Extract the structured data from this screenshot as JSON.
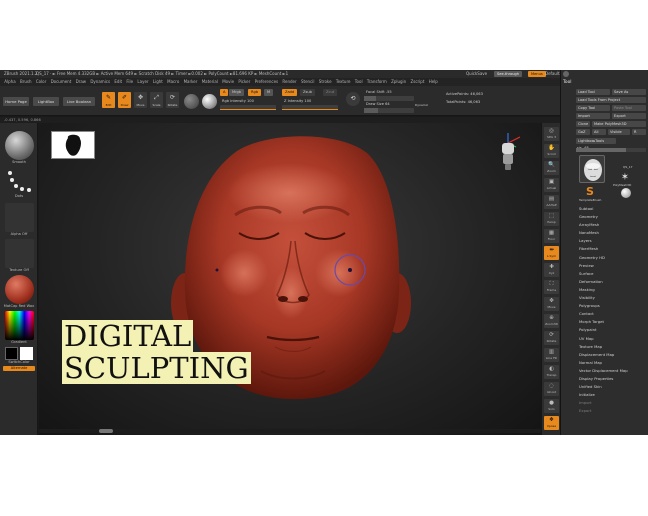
{
  "window": {
    "title": "ZBrush 2021.1.2",
    "title_stats": "QS_17  ·  ► Free Mem 4.332GB ► Active Mem 649 ► Scratch Disk 49 ► Timer ►0.002 ► PolyCount ►81.696 KP ► MeshCount ►1",
    "quicksave": "QuickSave",
    "seethrough": "See-through",
    "menus_btn": "Menus",
    "script": "DefaultZScript"
  },
  "menubar": [
    "Alpha",
    "Brush",
    "Color",
    "Document",
    "Draw",
    "Dynamics",
    "Edit",
    "File",
    "Layer",
    "Light",
    "Macro",
    "Marker",
    "Material",
    "Movie",
    "Picker",
    "Preferences",
    "Render",
    "Stencil",
    "Stroke",
    "Texture",
    "Tool",
    "Transform",
    "Zplugin",
    "Zscript",
    "Help"
  ],
  "shelf": {
    "home_page": "Home Page",
    "lightbox": "LightBox",
    "live_boolean": "Live Boolean",
    "tools": [
      {
        "label": "Edit",
        "icon": "edit-icon",
        "glyph": "✎"
      },
      {
        "label": "Draw",
        "icon": "draw-icon",
        "glyph": "✐"
      },
      {
        "label": "Move",
        "icon": "move-icon",
        "glyph": "✥"
      },
      {
        "label": "Scale",
        "icon": "scale-icon",
        "glyph": "⤢"
      },
      {
        "label": "Rotate",
        "icon": "rotate-icon",
        "glyph": "⟳"
      }
    ],
    "a_chip": "A",
    "mrgb": "Mrgb",
    "rgb": "Rgb",
    "m": "M",
    "rgb_intensity_label": "Rgb Intensity",
    "rgb_intensity": "100",
    "zadd": "Zadd",
    "zsub": "Zsub",
    "zcut": "Zcut",
    "z_intensity_label": "Z Intensity",
    "z_intensity": "100",
    "focal_shift_label": "Focal Shift",
    "focal_shift": "-55",
    "draw_size_label": "Draw Size",
    "draw_size": "64",
    "dynamic": "Dynamic",
    "active_points_label": "ActivePoints:",
    "active_points": "46,063",
    "total_points_label": "TotalPoints:",
    "total_points": "46,063"
  },
  "status": "-0.437, 0.596, 0.866",
  "left_tray": {
    "brush": "Smooth",
    "stroke": "Dots",
    "alpha": "Alpha Off",
    "texture": "Texture Off",
    "material": "MatCap Red Wax",
    "gradient": "Gradient",
    "switch_color": "SwitchColor",
    "alternate": "Alternate"
  },
  "viewport": {
    "overlay_line1": "DIGITAL",
    "overlay_line2": "SCULPTING"
  },
  "right_shelf": [
    {
      "label": "SPix 3",
      "icon": "spix-icon",
      "glyph": "◎"
    },
    {
      "label": "Scroll",
      "icon": "scroll-icon",
      "glyph": "✋"
    },
    {
      "label": "Zoom",
      "icon": "zoom-icon",
      "glyph": "🔍"
    },
    {
      "label": "Actual",
      "icon": "actual-icon",
      "glyph": "▣"
    },
    {
      "label": "AAHalf",
      "icon": "aahalf-icon",
      "glyph": "▤"
    },
    {
      "label": "Persp",
      "icon": "persp-icon",
      "glyph": "⬚"
    },
    {
      "label": "Floor",
      "icon": "floor-icon",
      "glyph": "▦"
    },
    {
      "label": "L.Sym",
      "icon": "lsym-icon",
      "glyph": "⇹"
    },
    {
      "label": "Xyz",
      "icon": "xyz-icon",
      "glyph": "✚"
    },
    {
      "label": "Frame",
      "icon": "frame-icon",
      "glyph": "⛶"
    },
    {
      "label": "Move",
      "icon": "move-view-icon",
      "glyph": "✥"
    },
    {
      "label": "Zoom3D",
      "icon": "zoom3d-icon",
      "glyph": "⊕"
    },
    {
      "label": "Rotate",
      "icon": "rotate-view-icon",
      "glyph": "⟳"
    },
    {
      "label": "Line Fill",
      "icon": "linefill-icon",
      "glyph": "▥"
    },
    {
      "label": "Transp",
      "icon": "transp-icon",
      "glyph": "◐"
    },
    {
      "label": "Ghost",
      "icon": "ghost-icon",
      "glyph": "◌"
    },
    {
      "label": "Solo",
      "icon": "solo-icon",
      "glyph": "●"
    },
    {
      "label": "Xpose",
      "icon": "xpose-icon",
      "glyph": "❖"
    }
  ],
  "tool_panel": {
    "title": "Tool",
    "load_tool": "Load Tool",
    "save_as": "Save As",
    "load_from_project": "Load Tools From Project",
    "copy_tool": "Copy Tool",
    "paste_tool": "Paste Tool",
    "import": "Import",
    "export": "Export",
    "clone": "Clone",
    "make_polymesh": "Make PolyMesh3D",
    "goz": "GoZ",
    "all": "All",
    "visible": "Visible",
    "r": "R",
    "lightbox_tools": "Lightbox▸Tools",
    "slider_label": "sis. 48",
    "thumb_current": "QS_17",
    "thumb_polymesh": "PolyMesh3D",
    "thumb_template": "TemplateBrush",
    "menus": [
      "Subtool",
      "Geometry",
      "ArrayMesh",
      "NanoMesh",
      "Layers",
      "FiberMesh",
      "Geometry HD",
      "Preview",
      "Surface",
      "Deformation",
      "Masking",
      "Visibility",
      "Polygroups",
      "Contact",
      "Morph Target",
      "Polypaint",
      "UV Map",
      "Texture Map",
      "Displacement Map",
      "Normal Map",
      "Vector Displacement Map",
      "Display Properties",
      "Unified Skin",
      "Initialize"
    ],
    "menus_dim": [
      "Import",
      "Export"
    ]
  },
  "colors": {
    "accent": "#e8891e",
    "wax": "#b5402e",
    "overlay_bg": "#f4f1b4"
  }
}
